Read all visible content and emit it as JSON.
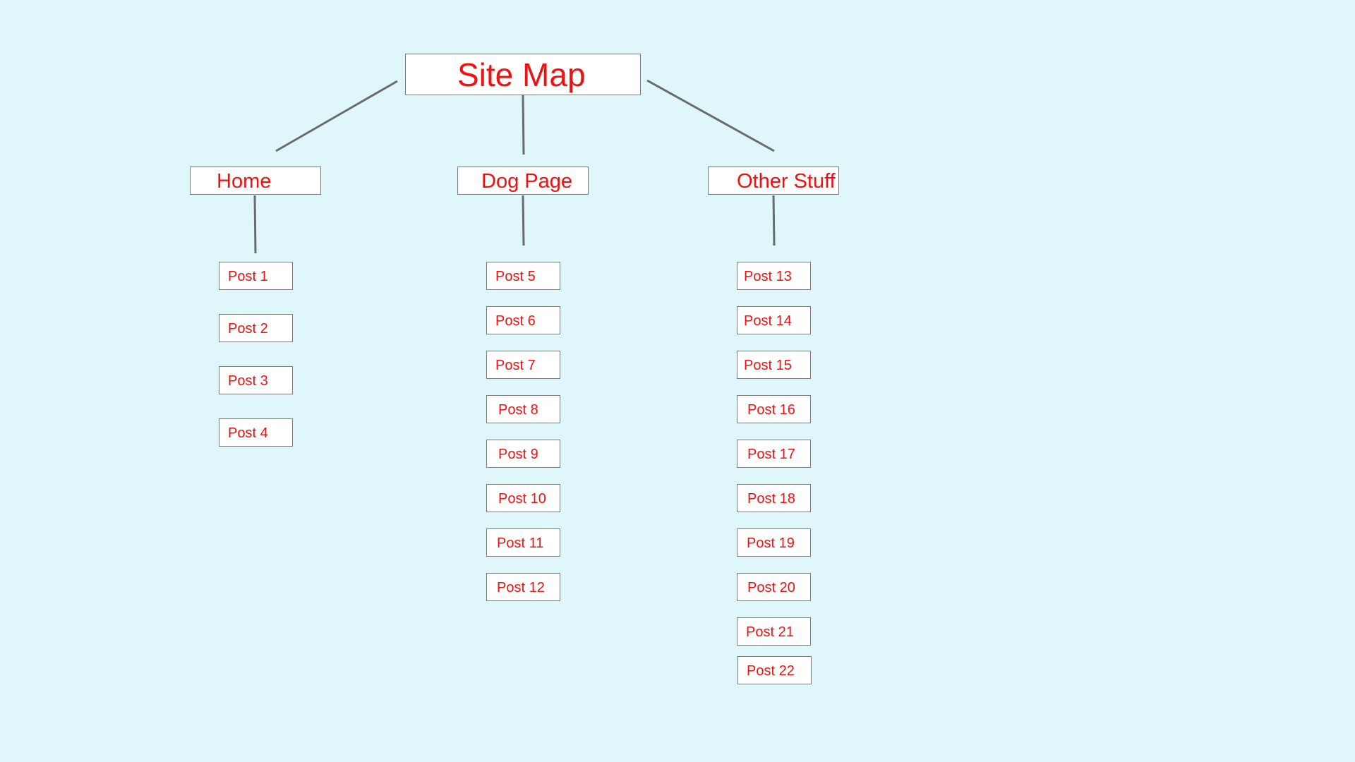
{
  "colors": {
    "background": "#dff7fb",
    "box_fill": "#ffffff",
    "box_border": "#7a7a7a",
    "text": "#ee1111",
    "connector": "#6b6b6b"
  },
  "diagram": {
    "title": "Site Map",
    "sections": [
      {
        "label": "Home",
        "posts": [
          "Post 1",
          "Post 2",
          "Post 3",
          "Post 4"
        ]
      },
      {
        "label": "Dog Page",
        "posts": [
          "Post 5",
          "Post 6",
          "Post 7",
          "Post 8",
          "Post 9",
          "Post 10",
          "Post 11",
          "Post 12"
        ]
      },
      {
        "label": "Other Stuff",
        "posts": [
          "Post 13",
          "Post 14",
          "Post 15",
          "Post 16",
          "Post 17",
          "Post 18",
          "Post 19",
          "Post 20",
          "Post 21",
          "Post 22"
        ]
      }
    ]
  }
}
